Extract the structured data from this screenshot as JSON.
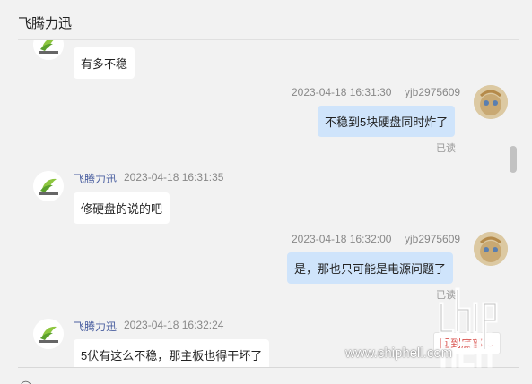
{
  "window": {
    "title": "飞腾力迅"
  },
  "messages": [
    {
      "direction": "in",
      "text": "有多不稳"
    },
    {
      "direction": "out",
      "time": "2023-04-18 16:31:30",
      "sender": "yjb2975609",
      "text": "不稳到5块硬盘同时炸了",
      "status": "已读"
    },
    {
      "direction": "in",
      "sender": "飞腾力迅",
      "time": "2023-04-18 16:31:35",
      "text": "修硬盘的说的吧"
    },
    {
      "direction": "out",
      "time": "2023-04-18 16:32:00",
      "sender": "yjb2975609",
      "text": "是，那也只可能是电源问题了",
      "status": "已读"
    },
    {
      "direction": "in",
      "sender": "飞腾力迅",
      "time": "2023-04-18 16:32:24",
      "text": "5伏有这么不稳，那主板也得干坏了"
    }
  ],
  "scroll_to_bottom_label": "回到底部",
  "watermark": {
    "url": "www.chiphell.com"
  },
  "colors": {
    "bubble_out": "#cfe4fb",
    "bubble_in": "#ffffff",
    "sender_name": "#4a5fa0",
    "scroll_bottom_text": "#d9534f"
  },
  "icons": {
    "brand_avatar": "leaf-logo-icon",
    "user_avatar": "cartoon-avatar-icon",
    "scroll_chevron": "chevron-down-icon"
  }
}
